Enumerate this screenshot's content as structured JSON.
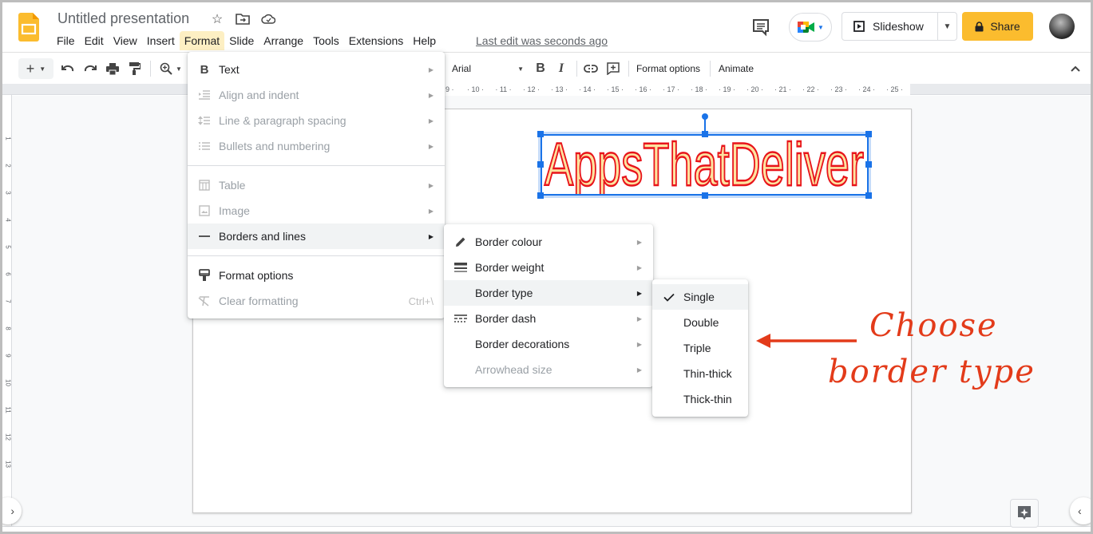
{
  "app": {
    "title": "Untitled presentation",
    "last_edit": "Last edit was seconds ago",
    "brand_color": "#fbbc2e"
  },
  "menubar": {
    "items": [
      {
        "label": "File"
      },
      {
        "label": "Edit"
      },
      {
        "label": "View"
      },
      {
        "label": "Insert"
      },
      {
        "label": "Format",
        "active": true
      },
      {
        "label": "Slide"
      },
      {
        "label": "Arrange"
      },
      {
        "label": "Tools"
      },
      {
        "label": "Extensions"
      },
      {
        "label": "Help"
      }
    ]
  },
  "header_actions": {
    "slideshow_label": "Slideshow",
    "share_label": "Share"
  },
  "toolbar": {
    "font_name": "Arial",
    "bold_label": "B",
    "italic_label": "I",
    "format_options_label": "Format options",
    "animate_label": "Animate"
  },
  "ruler": {
    "horizontal_ticks": [
      "9",
      "10",
      "11",
      "12",
      "13",
      "14",
      "15",
      "16",
      "17",
      "18",
      "19",
      "20",
      "21",
      "22",
      "23",
      "24",
      "25"
    ],
    "vertical_ticks": [
      "1",
      "2",
      "3",
      "4",
      "5",
      "6",
      "7",
      "8",
      "9",
      "10",
      "11",
      "12",
      "13"
    ]
  },
  "slide": {
    "wordart_text": "AppsThatDeliver",
    "wordart_fill": "#fde3a0",
    "wordart_stroke": "#e8141b"
  },
  "format_menu": {
    "items": [
      {
        "label": "Text",
        "icon": "bold-icon",
        "disabled": false,
        "submenu": true
      },
      {
        "label": "Align and indent",
        "icon": "indent-icon",
        "disabled": true,
        "submenu": true
      },
      {
        "label": "Line & paragraph spacing",
        "icon": "line-spacing-icon",
        "disabled": true,
        "submenu": true
      },
      {
        "label": "Bullets and numbering",
        "icon": "bulleted-list-icon",
        "disabled": true,
        "submenu": true
      },
      {
        "label": "Table",
        "icon": "table-icon",
        "disabled": true,
        "submenu": true
      },
      {
        "label": "Image",
        "icon": "image-icon",
        "disabled": true,
        "submenu": true
      },
      {
        "label": "Borders and lines",
        "icon": "line-icon",
        "disabled": false,
        "submenu": true,
        "highlighted": true
      },
      {
        "label": "Format options",
        "icon": "format-paint-icon",
        "disabled": false,
        "submenu": false
      },
      {
        "label": "Clear formatting",
        "icon": "clear-format-icon",
        "disabled": true,
        "submenu": false,
        "shortcut": "Ctrl+\\"
      }
    ]
  },
  "borders_menu": {
    "items": [
      {
        "label": "Border colour",
        "icon": "pencil-icon",
        "disabled": false
      },
      {
        "label": "Border weight",
        "icon": "line-weight-icon",
        "disabled": false
      },
      {
        "label": "Border type",
        "icon": "",
        "disabled": false,
        "highlighted": true
      },
      {
        "label": "Border dash",
        "icon": "line-dash-icon",
        "disabled": false
      },
      {
        "label": "Border decorations",
        "icon": "",
        "disabled": false
      },
      {
        "label": "Arrowhead size",
        "icon": "",
        "disabled": true
      }
    ]
  },
  "border_type_menu": {
    "items": [
      {
        "label": "Single",
        "checked": true
      },
      {
        "label": "Double",
        "checked": false
      },
      {
        "label": "Triple",
        "checked": false
      },
      {
        "label": "Thin-thick",
        "checked": false
      },
      {
        "label": "Thick-thin",
        "checked": false
      }
    ]
  },
  "annotation": {
    "line1": "Choose",
    "line2": "border type",
    "color": "#e33b1a"
  }
}
